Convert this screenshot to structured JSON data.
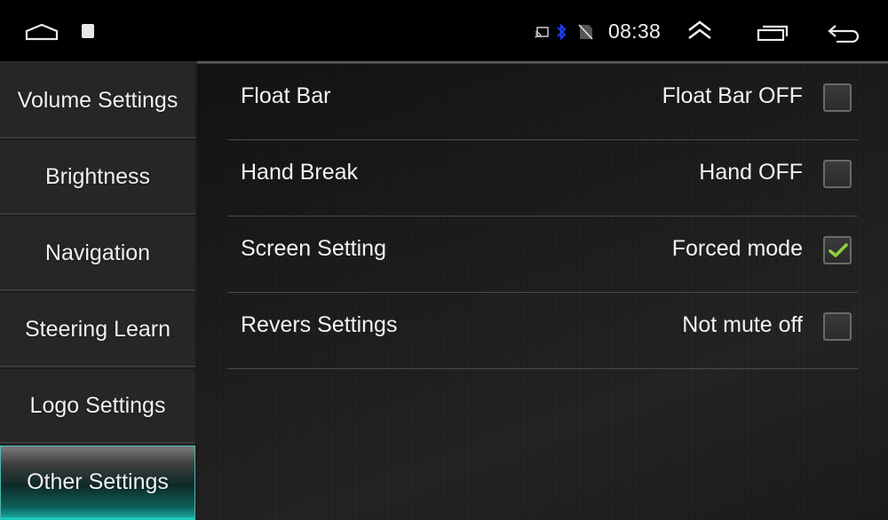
{
  "status_bar": {
    "time": "08:38",
    "icons": [
      "home-icon",
      "recent-app-thumbnail-icon",
      "cast-icon",
      "bluetooth-icon",
      "no-sim-icon",
      "expand-up-icon",
      "recents-icon",
      "back-icon"
    ],
    "bluetooth_color": "#1a3cff"
  },
  "sidebar": {
    "items": [
      {
        "label": "Volume Settings",
        "active": false
      },
      {
        "label": "Brightness",
        "active": false
      },
      {
        "label": "Navigation",
        "active": false
      },
      {
        "label": "Steering Learn",
        "active": false
      },
      {
        "label": "Logo Settings",
        "active": false
      },
      {
        "label": "Other Settings",
        "active": true
      }
    ],
    "accent_color": "#1ec8bd"
  },
  "settings": {
    "rows": [
      {
        "label": "Float Bar",
        "status": "Float Bar OFF",
        "checked": false
      },
      {
        "label": "Hand Break",
        "status": "Hand OFF",
        "checked": false
      },
      {
        "label": "Screen Setting",
        "status": "Forced mode",
        "checked": true
      },
      {
        "label": "Revers Settings",
        "status": "Not mute off",
        "checked": false
      }
    ],
    "check_color": "#8fd13a"
  }
}
